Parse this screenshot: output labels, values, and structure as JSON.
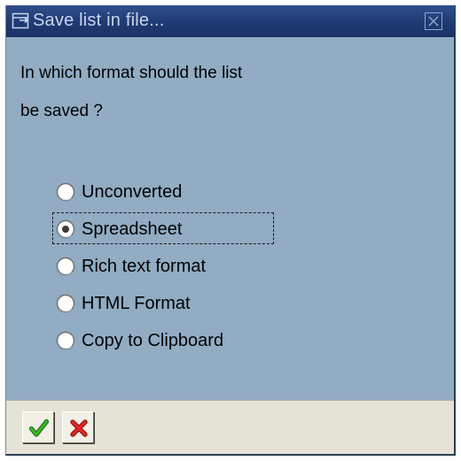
{
  "window": {
    "title": "Save list in file...",
    "title_icon": "dialog-icon",
    "close_icon": "close-icon"
  },
  "prompt": {
    "line1": "In which format should the list",
    "line2": "be saved ?"
  },
  "options": [
    {
      "label": "Unconverted",
      "selected": false
    },
    {
      "label": "Spreadsheet",
      "selected": true
    },
    {
      "label": "Rich text format",
      "selected": false
    },
    {
      "label": "HTML Format",
      "selected": false
    },
    {
      "label": "Copy to Clipboard",
      "selected": false
    }
  ],
  "footer": {
    "ok_icon": "checkmark-icon",
    "cancel_icon": "cancel-x-icon"
  },
  "colors": {
    "titlebar": "#1f3a73",
    "body": "#91acc3",
    "footer": "#e5e2d6",
    "ok_green": "#2f9a1c",
    "cancel_red": "#d81e1e"
  }
}
